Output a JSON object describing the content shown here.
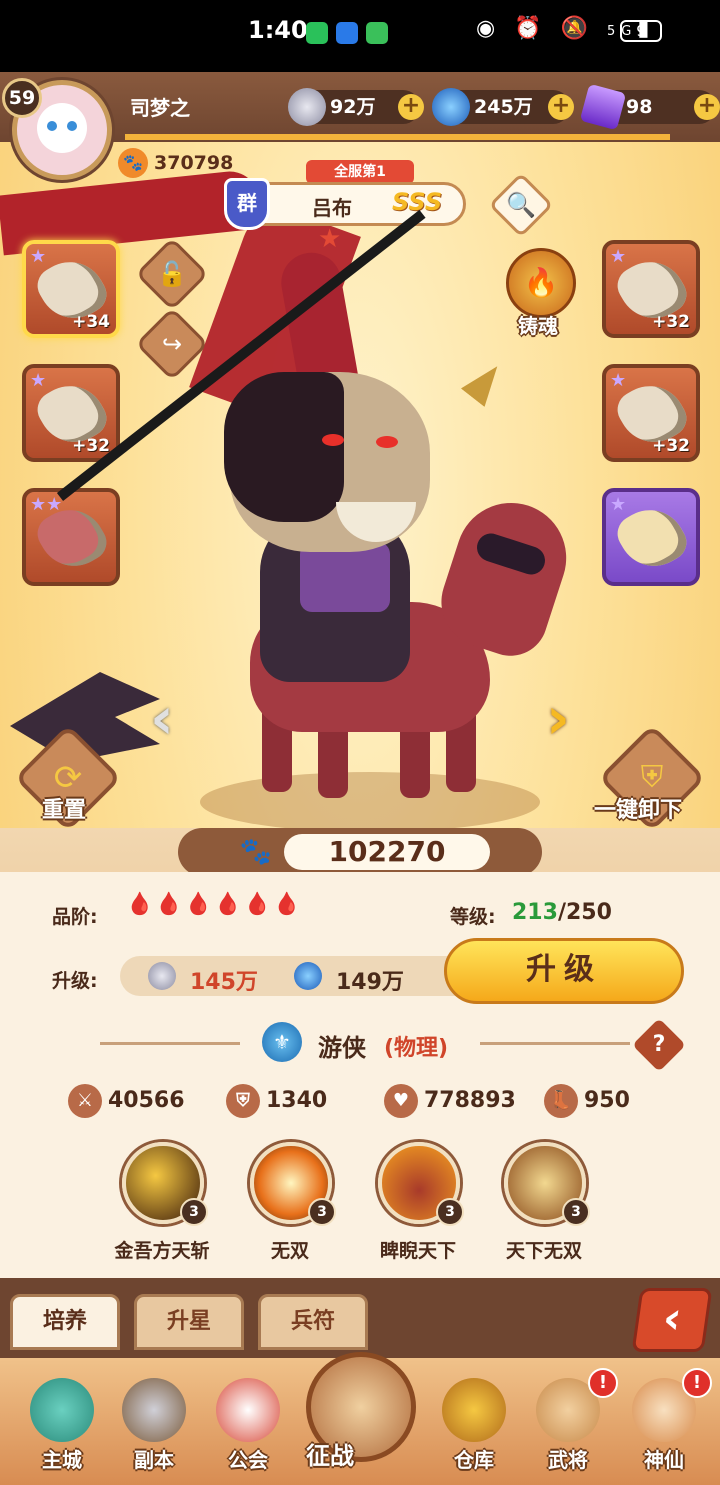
{
  "statusbar": {
    "time": "1:40",
    "network": "5G",
    "battery": "9"
  },
  "player": {
    "level": "59",
    "name": "司梦之",
    "power_score": "370798"
  },
  "resources": {
    "coins": "92万",
    "gems": "245万",
    "crystals": "98"
  },
  "hero": {
    "rank_tag": "全服第1",
    "faction": "群",
    "name": "吕布",
    "grade": "SSS",
    "combat_power": "102270"
  },
  "equipment": {
    "left": [
      {
        "level": "+34"
      },
      {
        "level": "+32"
      },
      {
        "level": ""
      }
    ],
    "right": [
      {
        "level": "+32"
      },
      {
        "level": "+32"
      },
      {
        "level": ""
      }
    ]
  },
  "actions": {
    "forge_label": "铸魂",
    "reset_label": "重置",
    "unequip_label": "一键卸下"
  },
  "info": {
    "quality_label": "品阶:",
    "quality_drops": "🩸🩸🩸🩸🩸🩸",
    "level_label": "等级:",
    "level_current": "213",
    "level_max": "/250",
    "upgrade_label": "升级:",
    "cost_coins": "145万",
    "cost_gems": "149万",
    "upgrade_button": "升级",
    "class_name": "游侠",
    "class_type": "(物理)"
  },
  "stats": {
    "attack": "40566",
    "defense": "1340",
    "hp": "778893",
    "speed": "950"
  },
  "skills": [
    {
      "name": "金吾方天斩",
      "level": "3"
    },
    {
      "name": "无双",
      "level": "3"
    },
    {
      "name": "睥睨天下",
      "level": "3"
    },
    {
      "name": "天下无双",
      "level": "3"
    }
  ],
  "tabs": [
    "培养",
    "升星",
    "兵符"
  ],
  "nav": {
    "items": [
      "主城",
      "副本",
      "公会",
      "征战",
      "仓库",
      "武将",
      "神仙"
    ]
  },
  "colors": {
    "accent": "#f5b922",
    "brown": "#6e4530",
    "red": "#e34a35"
  }
}
